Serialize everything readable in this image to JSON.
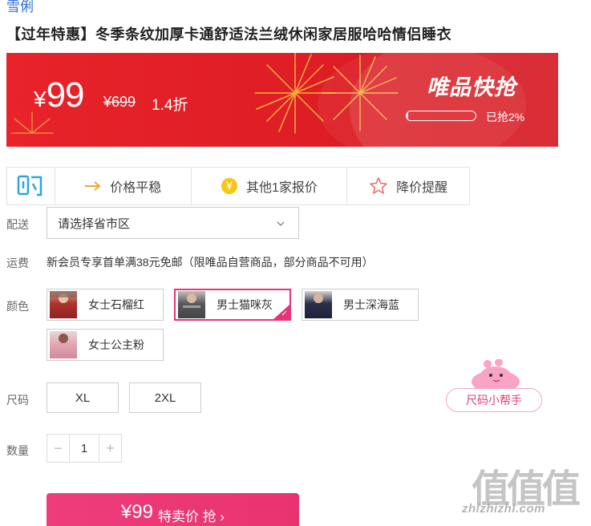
{
  "brand": "雪俐",
  "title": "【过年特惠】冬季条纹加厚卡通舒适法兰绒休闲家居服哈哈情侣睡衣",
  "banner": {
    "currency": "¥",
    "price": "99",
    "original_price": "¥699",
    "discount": "1.4折",
    "flash_label": "唯品快抢",
    "sold_percent": 0.02,
    "sold_text": "已抢2%",
    "bg_color": "#e3202a"
  },
  "tools": {
    "buy_icon": "gou-icon",
    "items": [
      {
        "icon": "arrow-right-icon",
        "label": "价格平稳"
      },
      {
        "icon": "yen-coin-icon",
        "label": "其他1家报价"
      },
      {
        "icon": "star-outline-icon",
        "label": "降价提醒"
      }
    ]
  },
  "delivery": {
    "label": "配送",
    "select_value": "请选择省市区"
  },
  "shipping": {
    "label": "运费",
    "text": "新会员专享首单满38元免邮（限唯品自营商品，部分商品不可用）"
  },
  "color": {
    "label": "颜色",
    "options": [
      {
        "label": "女士石榴红",
        "selected": false
      },
      {
        "label": "男士猫咪灰",
        "selected": true
      },
      {
        "label": "男士深海蓝",
        "selected": false
      },
      {
        "label": "女士公主粉",
        "selected": false
      }
    ]
  },
  "size": {
    "label": "尺码",
    "options": [
      "XL",
      "2XL"
    ],
    "helper_label": "尺码小帮手"
  },
  "quantity": {
    "label": "数量",
    "minus": "−",
    "value": "1",
    "plus": "+"
  },
  "buy_button": {
    "price": "¥99",
    "text": "特卖价 抢 ›",
    "color": "#ec3875"
  },
  "watermark": {
    "logo": "值值值",
    "url": "zhizhizhi.com"
  }
}
